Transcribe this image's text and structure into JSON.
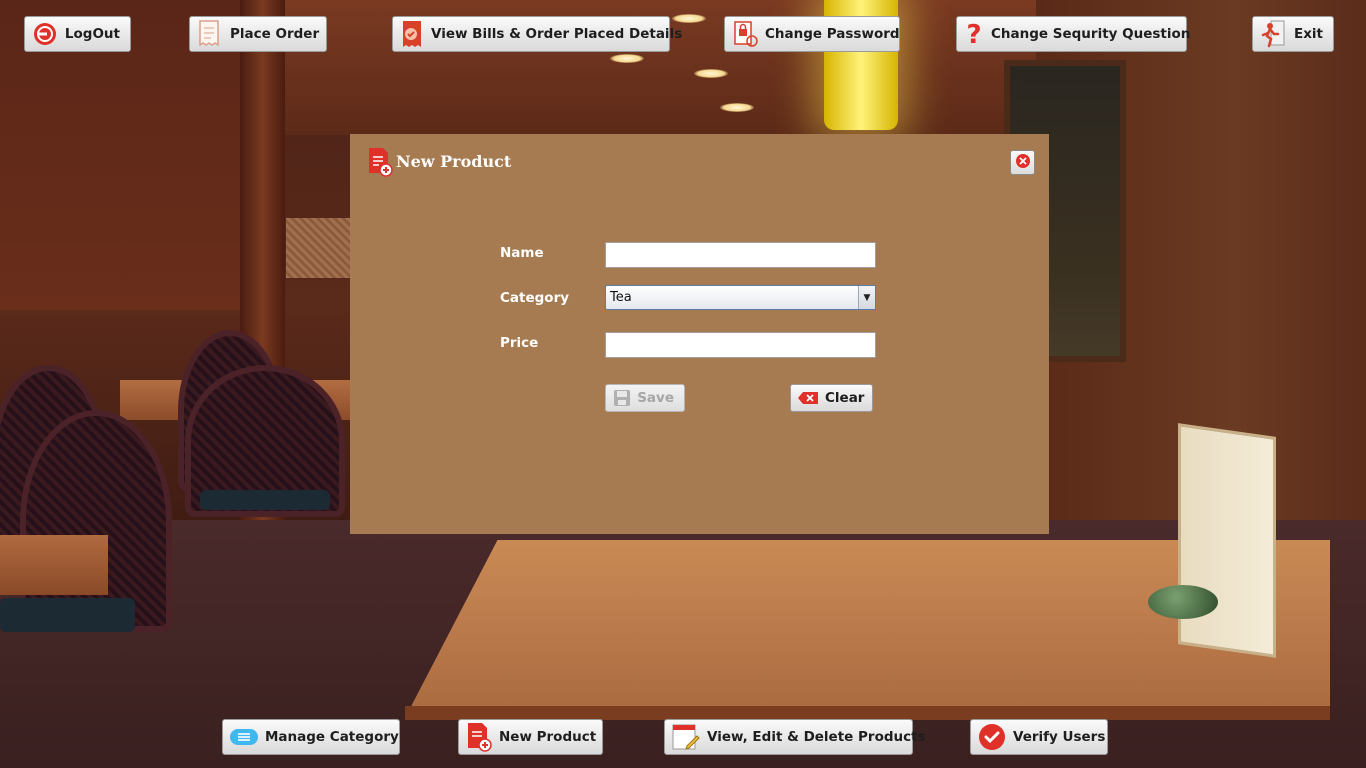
{
  "top_nav": {
    "logout": "LogOut",
    "place_order": "Place Order",
    "view_bills": "View Bills & Order Placed Details",
    "change_password": "Change Password",
    "change_security": "Change Sequrity Question",
    "exit": "Exit"
  },
  "dialog": {
    "title": "New Product",
    "fields": {
      "name_label": "Name",
      "name_value": "",
      "category_label": "Category",
      "category_value": "Tea",
      "price_label": "Price",
      "price_value": ""
    },
    "buttons": {
      "save": "Save",
      "save_enabled": false,
      "clear": "Clear"
    }
  },
  "bottom_nav": {
    "manage_category": "Manage Category",
    "new_product": "New Product",
    "view_edit_delete": "View, Edit & Delete Products",
    "verify_users": "Verify Users"
  },
  "icons": {
    "logout": "power-icon",
    "place_order": "receipt-icon",
    "view_bills": "bill-icon",
    "change_password": "lock-document-icon",
    "change_security": "question-icon",
    "exit": "running-man-icon",
    "close": "close-icon",
    "save": "floppy-disk-icon",
    "clear": "eraser-icon",
    "manage_category": "category-icon",
    "new_product": "add-document-icon",
    "view_edit_delete": "edit-document-icon",
    "verify_users": "verify-badge-icon"
  },
  "colors": {
    "dialog_background": "#a77b51",
    "accent_red": "#e0302a"
  }
}
